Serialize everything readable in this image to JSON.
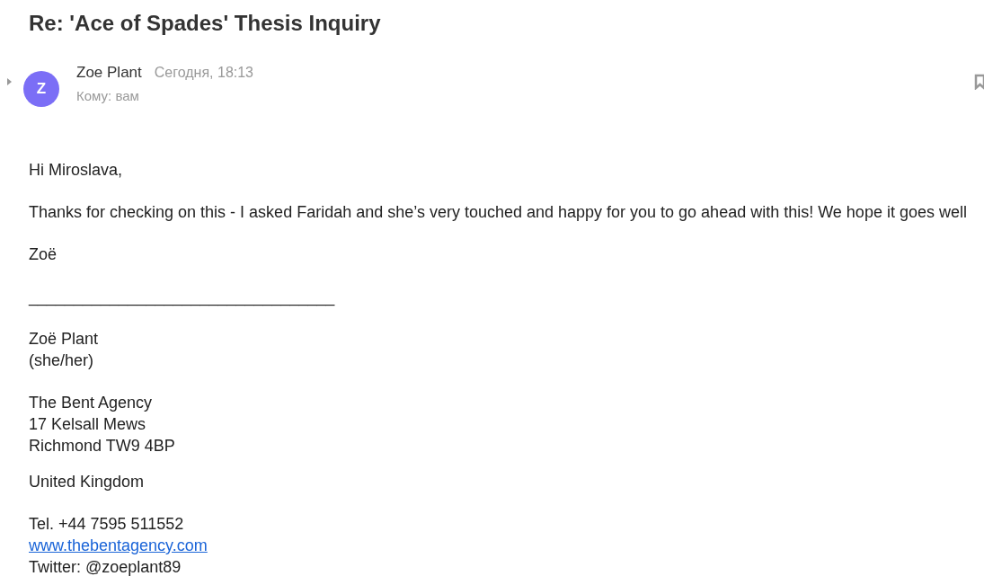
{
  "subject": "Re: 'Ace of Spades' Thesis Inquiry",
  "message": {
    "sender": "Zoe Plant",
    "avatar_letter": "Z",
    "date": "Сегодня, 18:13",
    "to": "Кому: вам"
  },
  "body": [
    {
      "lines": [
        {
          "kind": "text",
          "text": "Hi Miroslava,"
        }
      ]
    },
    {
      "lines": [
        {
          "kind": "text",
          "text": "Thanks for checking on this - I asked Faridah and she’s very touched and happy for you to go ahead with this! We hope it goes well"
        }
      ]
    },
    {
      "lines": [
        {
          "kind": "text",
          "text": "Zoë"
        }
      ]
    },
    {
      "lines": [
        {
          "kind": "text",
          "text": "__________________________________"
        }
      ]
    },
    {
      "lines": [
        {
          "kind": "text",
          "text": "Zoë Plant"
        },
        {
          "kind": "text",
          "text": "(she/her)"
        }
      ]
    },
    {
      "lines": [
        {
          "kind": "text",
          "text": "The Bent Agency"
        },
        {
          "kind": "text",
          "text": "17 Kelsall Mews"
        },
        {
          "kind": "text",
          "text": "Richmond TW9 4BP"
        }
      ]
    },
    {
      "lines": [
        {
          "kind": "text",
          "text": "United Kingdom"
        }
      ]
    },
    {
      "lines": [
        {
          "kind": "text",
          "text": "Tel. +44 7595 511552"
        },
        {
          "kind": "link",
          "text": "www.thebentagency.com"
        },
        {
          "kind": "text",
          "text": "Twitter: @zoeplant89"
        }
      ]
    }
  ]
}
